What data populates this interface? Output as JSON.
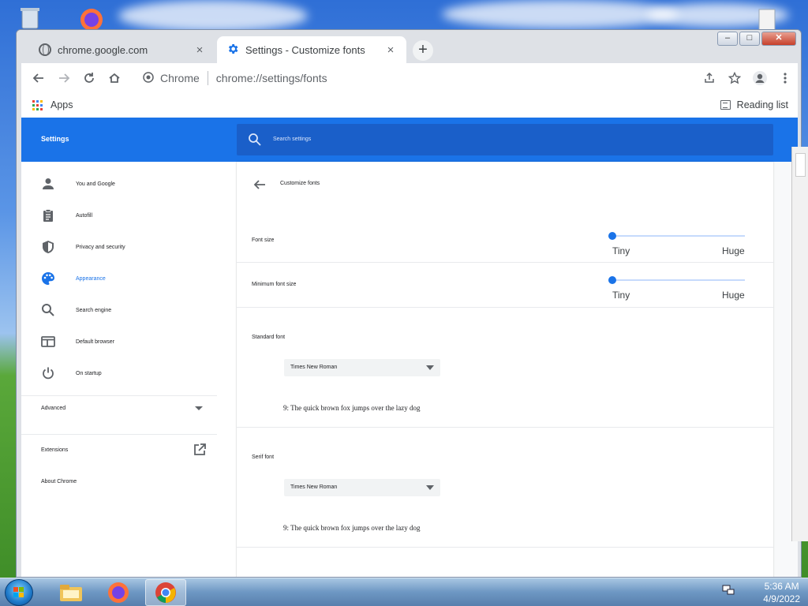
{
  "window": {
    "tabs": [
      {
        "label": "chrome.google.com",
        "icon": "globe-icon",
        "close": "×"
      },
      {
        "label": "Settings - Customize fonts",
        "icon": "gear-icon",
        "close": "×"
      }
    ],
    "newtab": "+",
    "controls": {
      "minimize": "–",
      "maximize": "□",
      "close": "✕"
    }
  },
  "toolbar": {
    "omnibox_site": "Chrome",
    "omnibox_url": "chrome://settings/fonts"
  },
  "bookmarks": {
    "apps_label": "Apps",
    "reading_list_label": "Reading list"
  },
  "settings": {
    "header_title": "Settings",
    "search_placeholder": "Search settings",
    "nav": [
      {
        "label": "You and Google",
        "icon": "person-icon"
      },
      {
        "label": "Autofill",
        "icon": "clipboard-icon"
      },
      {
        "label": "Privacy and security",
        "icon": "shield-icon"
      },
      {
        "label": "Appearance",
        "icon": "palette-icon",
        "active": true
      },
      {
        "label": "Search engine",
        "icon": "search-icon"
      },
      {
        "label": "Default browser",
        "icon": "browser-icon"
      },
      {
        "label": "On startup",
        "icon": "power-icon"
      }
    ],
    "advanced_label": "Advanced",
    "extensions_label": "Extensions",
    "about_label": "About Chrome"
  },
  "fonts_page": {
    "title": "Customize fonts",
    "font_size": {
      "label": "Font size",
      "min_label": "Tiny",
      "max_label": "Huge",
      "value": 0
    },
    "minimum_font_size": {
      "label": "Minimum font size",
      "min_label": "Tiny",
      "max_label": "Huge",
      "value": 0
    },
    "standard_font": {
      "label": "Standard font",
      "value": "Times New Roman",
      "sample": "9: The quick brown fox jumps over the lazy dog"
    },
    "serif_font": {
      "label": "Serif font",
      "value": "Times New Roman",
      "sample": "9: The quick brown fox jumps over the lazy dog"
    }
  },
  "taskbar": {
    "time": "5:36 AM",
    "date": "4/9/2022"
  },
  "colors": {
    "accent": "#1a73e8",
    "header": "#1a73e8",
    "search_box": "#1a5fc9"
  }
}
